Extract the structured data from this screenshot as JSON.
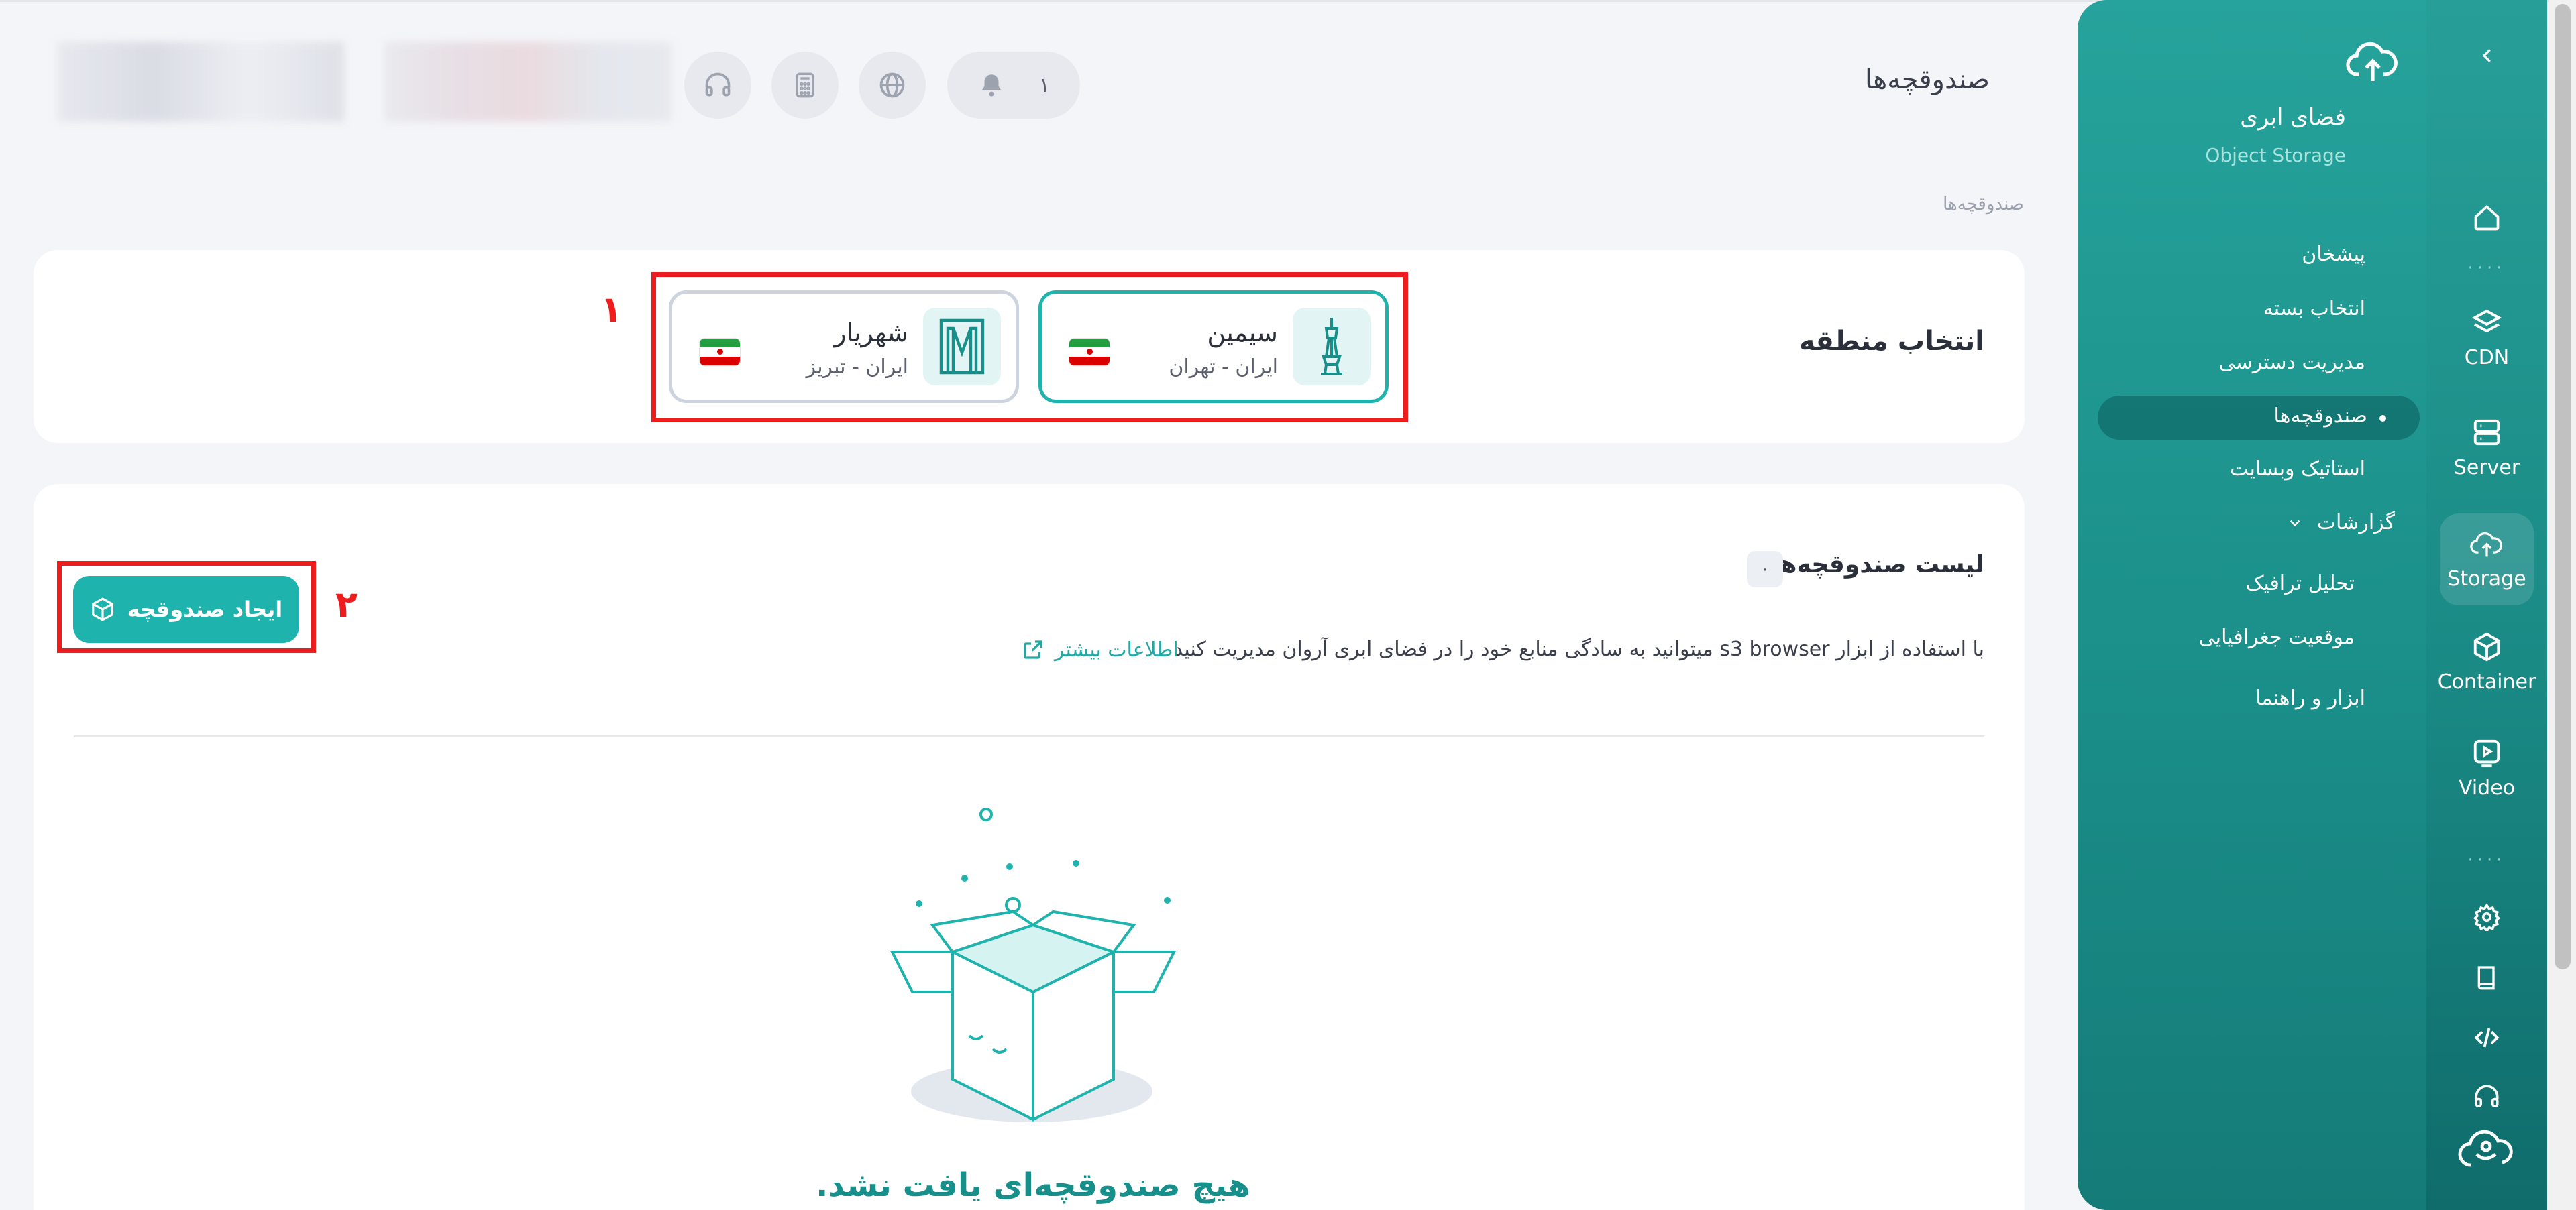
{
  "header": {
    "page_title": "صندوقچه‌ها",
    "notification_count": "۱",
    "buttons": [
      "bell-icon",
      "globe-icon",
      "calculator-icon",
      "headset-icon"
    ]
  },
  "breadcrumb": "صندوقچه‌ها",
  "sidebar": {
    "product_title": "فضای ابری",
    "product_subtitle": "Object Storage",
    "nav": [
      {
        "label": "پیشخان"
      },
      {
        "label": "انتخاب بسته"
      },
      {
        "label": "مدیریت دسترسی"
      },
      {
        "label": "صندوقچه‌ها",
        "active": true
      },
      {
        "label": "استاتیک وبسایت"
      },
      {
        "label": "گزارشات",
        "expandable": true
      },
      {
        "label": "تحلیل ترافیک"
      },
      {
        "label": "موقعیت جغرافیایی"
      },
      {
        "label": "ابزار و راهنما"
      }
    ],
    "rail": [
      {
        "label": "",
        "icon": "home-icon"
      },
      {
        "label": "CDN",
        "icon": "cdn-icon"
      },
      {
        "label": "Server",
        "icon": "server-icon"
      },
      {
        "label": "Storage",
        "icon": "storage-icon",
        "active": true
      },
      {
        "label": "Container",
        "icon": "container-icon"
      },
      {
        "label": "Video",
        "icon": "video-icon"
      }
    ],
    "rail_bottom": [
      "settings-icon",
      "book-icon",
      "code-icon",
      "support-icon",
      "arvan-logo"
    ]
  },
  "region": {
    "label": "انتخاب منطقه",
    "annotation": "۱",
    "options": [
      {
        "name": "سیمین",
        "location": "ایران - تهران",
        "selected": true,
        "icon": "milad-tower-icon"
      },
      {
        "name": "شهریار",
        "location": "ایران - تبریز",
        "selected": false,
        "icon": "gate-icon"
      }
    ]
  },
  "buckets": {
    "title": "لیست صندوقچه‌ها",
    "count": "۰",
    "description": "با استفاده از ابزار s3 browser میتوانید به سادگی منابع خود را در فضای ابری آروان مدیریت کنید",
    "more_link": "اطلاعات بیشتر",
    "create_button": "ایجاد صندوقچه",
    "create_annotation": "۲",
    "empty_message": "هیچ صندوقچه‌ای یافت نشد."
  },
  "colors": {
    "accent": "#1fb3ad",
    "annotation": "#ee1c1c",
    "sidebar": "#1a8d88"
  }
}
